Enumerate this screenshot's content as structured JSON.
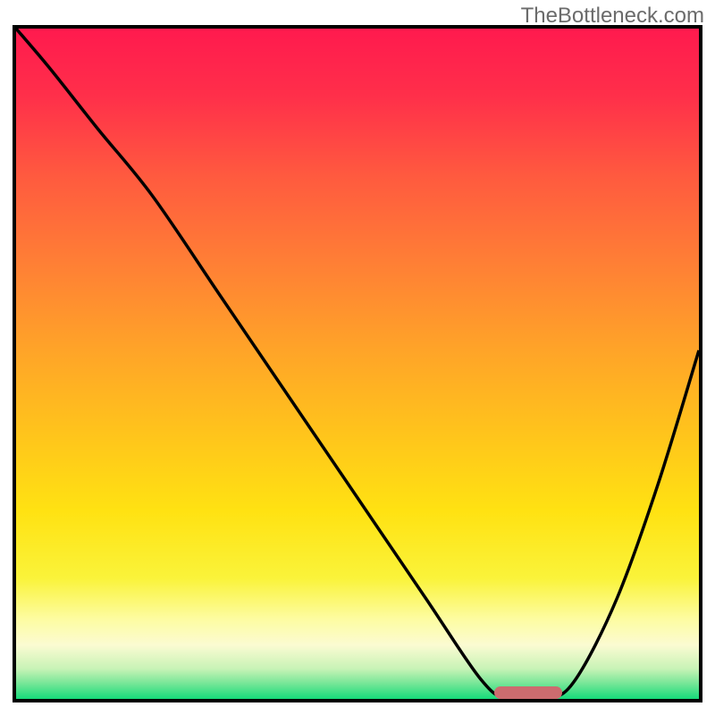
{
  "attribution": "TheBottleneck.com",
  "colors": {
    "border": "#000000",
    "curve": "#000000",
    "highlight": "#cc6c6f",
    "gradient_stops": [
      {
        "offset": 0.0,
        "color": "#ff1a4e"
      },
      {
        "offset": 0.1,
        "color": "#ff2f4a"
      },
      {
        "offset": 0.22,
        "color": "#ff5a3f"
      },
      {
        "offset": 0.35,
        "color": "#ff7f35"
      },
      {
        "offset": 0.48,
        "color": "#ffa428"
      },
      {
        "offset": 0.6,
        "color": "#ffc31c"
      },
      {
        "offset": 0.72,
        "color": "#ffe212"
      },
      {
        "offset": 0.82,
        "color": "#faf33a"
      },
      {
        "offset": 0.88,
        "color": "#fdfca0"
      },
      {
        "offset": 0.92,
        "color": "#fbfbd2"
      },
      {
        "offset": 0.955,
        "color": "#c8f3b6"
      },
      {
        "offset": 0.975,
        "color": "#7ee79a"
      },
      {
        "offset": 1.0,
        "color": "#16db7a"
      }
    ]
  },
  "chart_data": {
    "type": "line",
    "title": "",
    "xlabel": "",
    "ylabel": "",
    "xlim": [
      0,
      100
    ],
    "ylim": [
      0,
      100
    ],
    "series": [
      {
        "name": "curve",
        "x": [
          0,
          5,
          12,
          20,
          30,
          40,
          50,
          60,
          68,
          72,
          78,
          82,
          88,
          94,
          100
        ],
        "y": [
          100,
          94,
          85,
          75,
          60,
          45,
          30,
          15,
          3,
          0,
          0,
          3,
          15,
          32,
          52
        ]
      }
    ],
    "highlight_segment": {
      "x_start": 70,
      "x_end": 80,
      "y": 0
    },
    "annotations": []
  }
}
